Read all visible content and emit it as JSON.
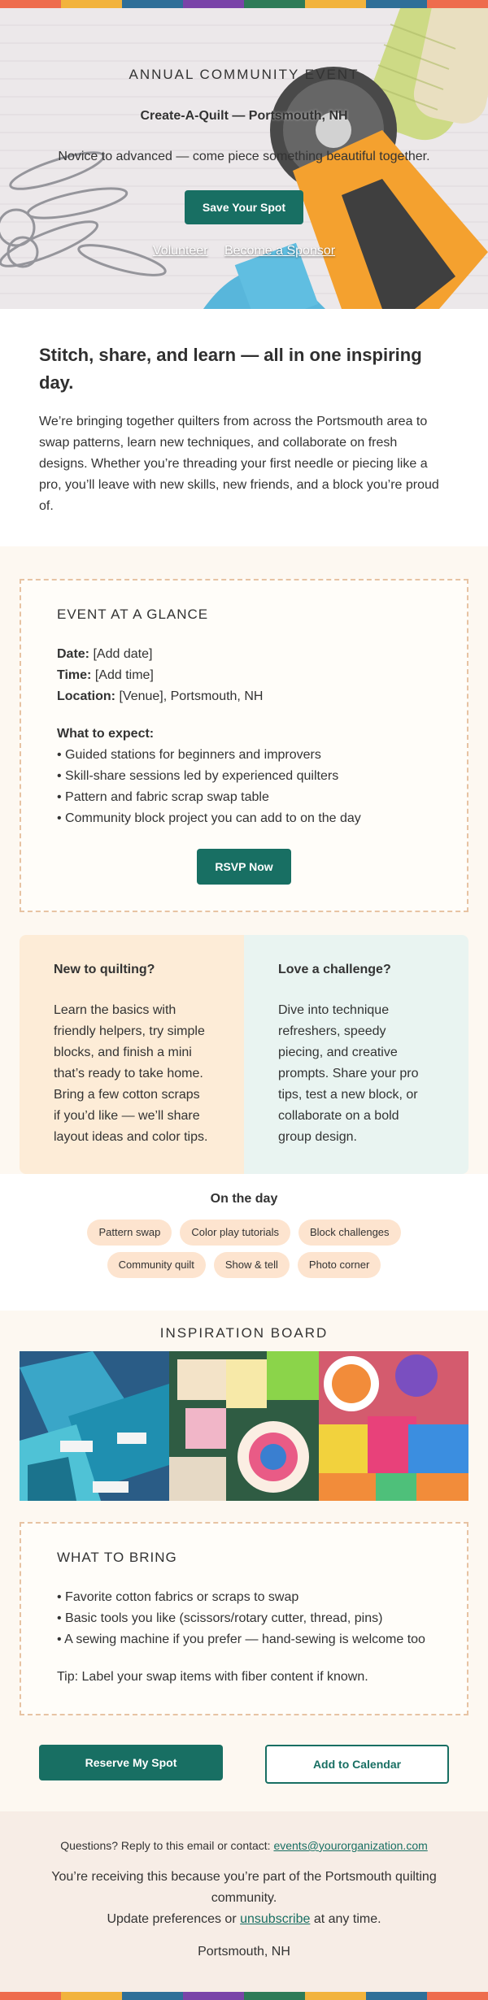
{
  "stripe_colors": [
    "#ee6c4d",
    "#f2b33d",
    "#2f6f98",
    "#7a44a8",
    "#2e7b57",
    "#f2b33d",
    "#2f6f98",
    "#ee6c4d"
  ],
  "hero": {
    "eyebrow": "ANNUAL COMMUNITY EVENT",
    "title": "Create-A-Quilt — Portsmouth, NH",
    "subtitle": "Novice to advanced — come piece something beautiful together.",
    "cta_label": "Save Your Spot",
    "links": [
      "Volunteer",
      "Become a Sponsor"
    ]
  },
  "intro": {
    "heading": "Stitch, share, and learn — all in one inspiring day.",
    "body": "We’re bringing together quilters from across the Portsmouth area to swap patterns, learn new techniques, and collaborate on fresh designs. Whether you’re threading your first needle or piecing like a pro, you’ll leave with new skills, new friends, and a block you’re proud of."
  },
  "glance": {
    "title": "EVENT AT A GLANCE",
    "date_label": "Date:",
    "date_value": "[Add date]",
    "time_label": "Time:",
    "time_value": "[Add time]",
    "location_label": "Location:",
    "location_value": "[Venue], Portsmouth, NH",
    "expect_heading": "What to expect:",
    "expect_items": [
      "• Guided stations for beginners and improvers",
      "• Skill-share sessions led by experienced quilters",
      "• Pattern and fabric scrap swap table",
      "• Community block project you can add to on the day"
    ],
    "rsvp_label": "RSVP Now"
  },
  "columns": {
    "left": {
      "title": "New to quilting?",
      "body": "Learn the basics with friendly helpers, try simple blocks, and finish a mini that’s ready to take home. Bring a few cotton scraps if you’d like — we’ll share layout ideas and color tips."
    },
    "right": {
      "title": "Love a challenge?",
      "body": "Dive into technique refreshers, speedy piecing, and creative prompts. Share your pro tips, test a new block, or collaborate on a bold group design."
    }
  },
  "day": {
    "title": "On the day",
    "chips": [
      "Pattern swap",
      "Color play tutorials",
      "Block challenges",
      "Community quilt",
      "Show & tell",
      "Photo corner"
    ]
  },
  "inspiration": {
    "title": "INSPIRATION BOARD"
  },
  "bring": {
    "title": "WHAT TO BRING",
    "items": [
      "• Favorite cotton fabrics or scraps to swap",
      "• Basic tools you like (scissors/rotary cutter, thread, pins)",
      "• A sewing machine if you prefer — hand-sewing is welcome too"
    ],
    "tip": "Tip: Label your swap items with fiber content if known."
  },
  "cta": {
    "primary": "Reserve My Spot",
    "secondary": "Add to Calendar"
  },
  "footer": {
    "contact_prefix": "Questions? Reply to this email or contact: ",
    "contact_email": "events@yourorganization.com",
    "reason": "You’re receiving this because you’re part of the Portsmouth quilting community.",
    "pref_prefix": "Update preferences or ",
    "unsubscribe": "unsubscribe",
    "pref_suffix": " at any time.",
    "location": "Portsmouth, NH"
  }
}
